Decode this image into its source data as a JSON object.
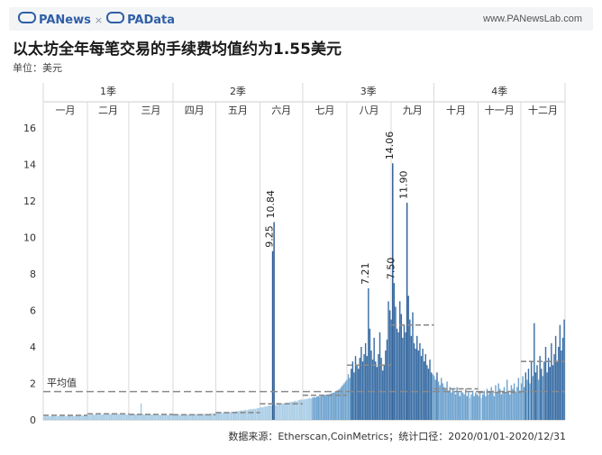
{
  "header": {
    "brand_left": "PANews",
    "brand_sep": "×",
    "brand_right": "PAData",
    "site": "www.PANewsLab.com"
  },
  "title": "以太坊全年每笔交易的手续费均值约为1.55美元",
  "unit_label": "单位：美元",
  "source": "数据来源：Etherscan,CoinMetrics；统计口径：2020/01/01-2020/12/31",
  "colors": {
    "bar_low": "#a9cde6",
    "bar_mid": "#6ea3cf",
    "bar_high": "#3a6ea5",
    "spike": "#2c5a91",
    "grid": "#d9d9d9",
    "avg_line": "#8a8a8a"
  },
  "chart_data": {
    "type": "bar",
    "title": "以太坊全年每笔交易的手续费均值约为1.55美元",
    "ylabel": "单位：美元",
    "ylim": [
      0,
      16
    ],
    "yticks": [
      0,
      2,
      4,
      6,
      8,
      10,
      12,
      14,
      16
    ],
    "quarters": [
      "1季",
      "2季",
      "3季",
      "4季"
    ],
    "months": [
      "一月",
      "二月",
      "三月",
      "四月",
      "五月",
      "六月",
      "七月",
      "八月",
      "九月",
      "十月",
      "十一月",
      "十二月"
    ],
    "average": {
      "label": "平均值",
      "value": 1.55
    },
    "monthly_average": [
      0.25,
      0.33,
      0.3,
      0.28,
      0.4,
      0.88,
      1.35,
      3.0,
      5.2,
      1.7,
      1.5,
      3.2
    ],
    "daily_fees": [
      0.18,
      0.19,
      0.2,
      0.19,
      0.21,
      0.2,
      0.22,
      0.2,
      0.19,
      0.21,
      0.22,
      0.2,
      0.21,
      0.23,
      0.22,
      0.2,
      0.21,
      0.22,
      0.24,
      0.23,
      0.22,
      0.21,
      0.23,
      0.24,
      0.22,
      0.23,
      0.25,
      0.24,
      0.23,
      0.24,
      0.25,
      0.26,
      0.27,
      0.28,
      0.3,
      0.28,
      0.29,
      0.31,
      0.3,
      0.29,
      0.28,
      0.3,
      0.32,
      0.31,
      0.3,
      0.29,
      0.31,
      0.33,
      0.32,
      0.31,
      0.3,
      0.32,
      0.33,
      0.31,
      0.3,
      0.32,
      0.31,
      0.3,
      0.29,
      0.28,
      0.27,
      0.29,
      0.28,
      0.3,
      0.31,
      0.29,
      0.28,
      0.27,
      0.9,
      0.3,
      0.29,
      0.28,
      0.27,
      0.28,
      0.29,
      0.3,
      0.28,
      0.27,
      0.26,
      0.27,
      0.28,
      0.27,
      0.26,
      0.27,
      0.28,
      0.29,
      0.28,
      0.27,
      0.26,
      0.28,
      0.27,
      0.28,
      0.29,
      0.27,
      0.26,
      0.27,
      0.28,
      0.29,
      0.3,
      0.28,
      0.29,
      0.3,
      0.31,
      0.3,
      0.29,
      0.3,
      0.32,
      0.31,
      0.3,
      0.32,
      0.33,
      0.31,
      0.32,
      0.34,
      0.33,
      0.32,
      0.34,
      0.35,
      0.36,
      0.35,
      0.36,
      0.38,
      0.37,
      0.39,
      0.4,
      0.38,
      0.41,
      0.4,
      0.42,
      0.43,
      0.41,
      0.44,
      0.45,
      0.43,
      0.46,
      0.48,
      0.47,
      0.5,
      0.52,
      0.49,
      0.53,
      0.55,
      0.52,
      0.56,
      0.58,
      0.6,
      0.57,
      0.62,
      0.6,
      0.63,
      0.65,
      0.66,
      0.7,
      0.68,
      0.72,
      0.75,
      0.73,
      0.78,
      0.8,
      0.77,
      9.25,
      10.84,
      0.82,
      0.8,
      0.85,
      0.88,
      0.86,
      0.9,
      0.88,
      0.92,
      0.95,
      0.93,
      0.97,
      1.0,
      0.98,
      1.02,
      1.05,
      1.0,
      1.08,
      1.1,
      1.12,
      1.1,
      1.12,
      1.15,
      1.13,
      1.18,
      1.2,
      1.17,
      1.22,
      1.25,
      1.23,
      1.28,
      1.3,
      1.27,
      1.32,
      1.35,
      1.33,
      1.38,
      1.4,
      1.37,
      1.42,
      1.45,
      1.48,
      1.5,
      1.55,
      1.6,
      1.65,
      1.7,
      1.8,
      1.9,
      2.0,
      2.1,
      2.2,
      2.5,
      2.3,
      2.8,
      3.2,
      2.6,
      3.5,
      3.0,
      2.8,
      3.4,
      4.0,
      3.2,
      3.6,
      4.2,
      3.5,
      7.21,
      5.0,
      3.8,
      3.3,
      4.5,
      3.2,
      2.9,
      3.6,
      4.8,
      3.4,
      2.7,
      3.0,
      3.8,
      4.4,
      6.5,
      6.0,
      5.5,
      14.06,
      7.5,
      6.2,
      5.0,
      4.8,
      6.5,
      5.8,
      4.5,
      5.2,
      4.8,
      11.9,
      6.8,
      5.5,
      4.6,
      5.9,
      4.2,
      3.9,
      4.6,
      3.8,
      4.2,
      3.5,
      3.9,
      3.2,
      3.6,
      3.0,
      2.8,
      3.3,
      2.6,
      2.5,
      2.4,
      2.2,
      2.6,
      2.1,
      1.9,
      2.3,
      2.0,
      1.8,
      1.7,
      2.1,
      1.6,
      1.8,
      1.5,
      1.7,
      1.6,
      1.4,
      1.8,
      1.5,
      1.3,
      1.6,
      1.5,
      1.4,
      1.7,
      1.3,
      1.5,
      1.2,
      1.4,
      1.6,
      1.3,
      1.5,
      1.4,
      1.3,
      1.5,
      1.2,
      1.4,
      1.6,
      1.3,
      1.7,
      1.4,
      1.5,
      1.8,
      1.6,
      1.3,
      1.9,
      1.5,
      2.0,
      1.7,
      1.4,
      1.6,
      1.8,
      1.5,
      2.2,
      1.6,
      1.4,
      1.9,
      1.7,
      2.0,
      1.5,
      1.8,
      2.3,
      1.6,
      2.0,
      2.4,
      1.8,
      2.6,
      2.2,
      2.8,
      2.0,
      3.2,
      2.4,
      5.3,
      2.6,
      3.0,
      2.2,
      3.5,
      2.8,
      2.4,
      3.2,
      4.0,
      2.6,
      3.4,
      2.9,
      4.2,
      3.0,
      3.6,
      4.6,
      3.2,
      4.0,
      5.2,
      3.8,
      4.5,
      5.5
    ]
  }
}
